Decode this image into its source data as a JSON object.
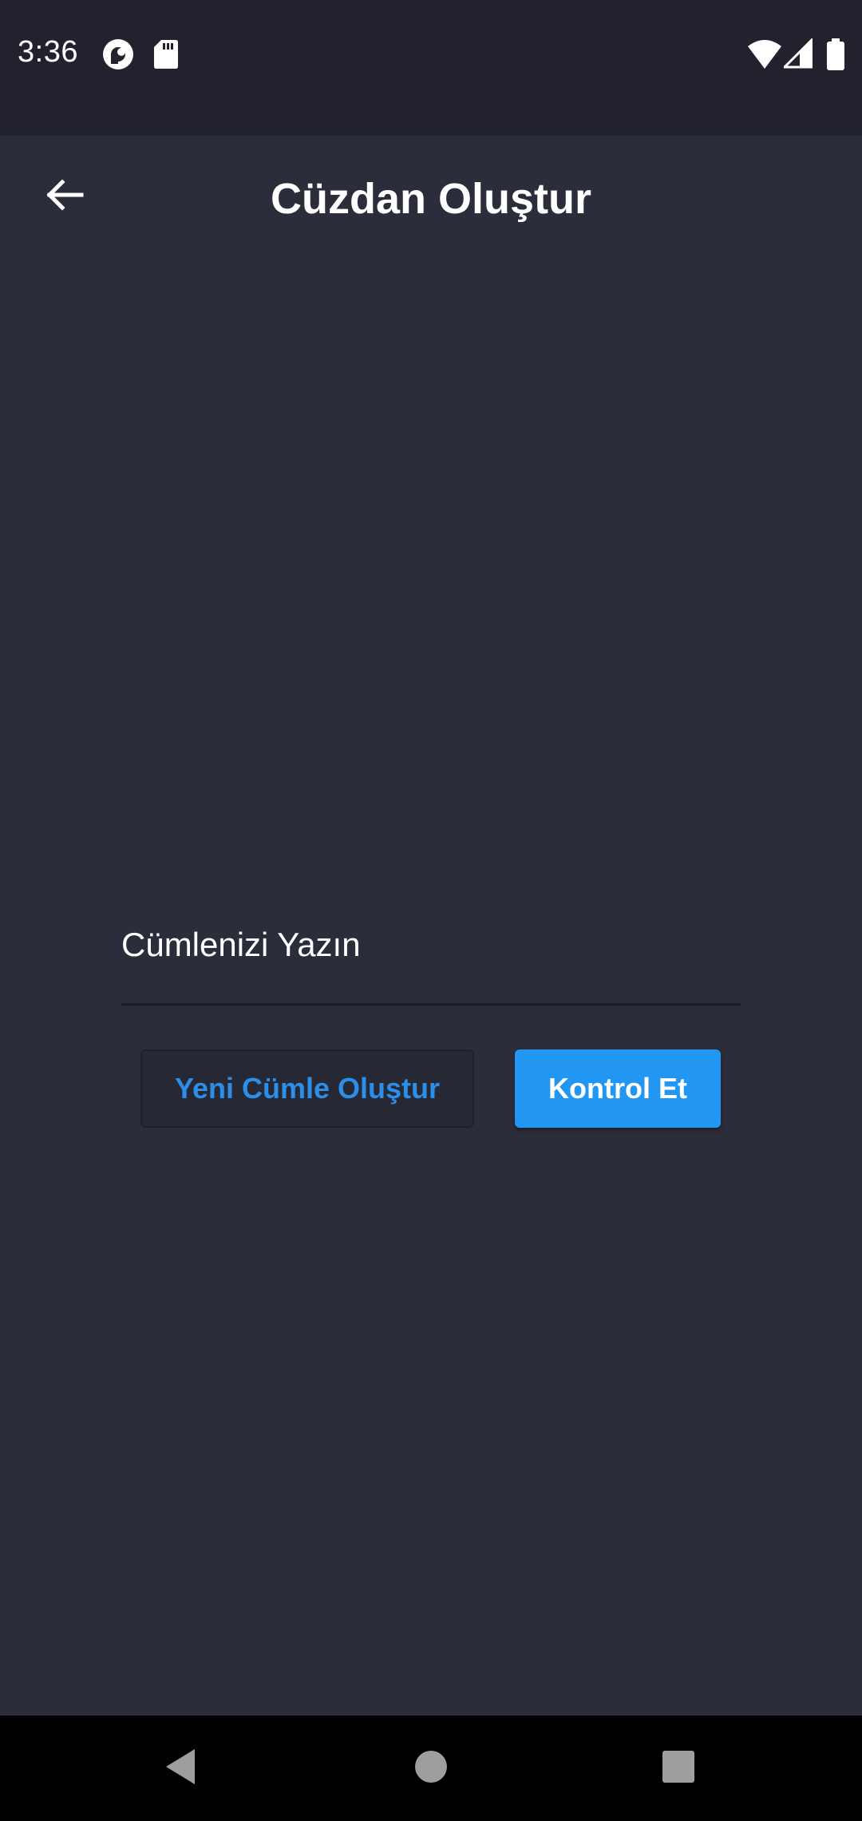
{
  "status_bar": {
    "time": "3:36",
    "icons": [
      "pocket-casts-icon",
      "sd-card-icon",
      "wifi-icon",
      "cell-signal-icon",
      "battery-icon"
    ]
  },
  "app_bar": {
    "back_icon": "arrow-back-icon",
    "title": "Cüzdan Oluştur"
  },
  "form": {
    "phrase_placeholder": "Cümlenizi Yazın",
    "phrase_value": ""
  },
  "buttons": {
    "generate_label": "Yeni Cümle Oluştur",
    "check_label": "Kontrol Et"
  },
  "nav_bar": {
    "icons": [
      "nav-back-icon",
      "nav-home-icon",
      "nav-recents-icon"
    ]
  },
  "colors": {
    "background": "#2b2d3b",
    "status_bar": "#21222d",
    "accent": "#2196f3",
    "accent_text": "#2c8ee9"
  }
}
